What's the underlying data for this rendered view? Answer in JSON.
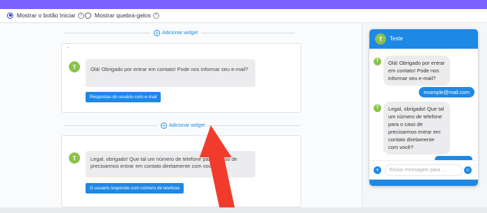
{
  "colors": {
    "top_bar": "#7b61ff",
    "accent": "#1e88e5",
    "avatar": "#8bc34a",
    "arrow": "#f13b2d"
  },
  "options": {
    "show_start_button": "Mostrar o botão Iniciar",
    "show_icebreakers": "Mostrar quebra-gelos",
    "help_glyph": "?"
  },
  "add_widget": "Adicionar widget",
  "add_glyph": "+",
  "avatar_letter": "T",
  "card1": {
    "dot": "·",
    "message": "Olá! Obrigado por entrar em contato! Pode nos informar seu e-mail?",
    "button": "Respostas do usuário com e-mail"
  },
  "card2": {
    "message_line1": "Legal, obrigado! Que tal um número de telefone para o caso de",
    "message_line2": "precisarmos entrar em contato diretamente com você?",
    "button": "O usuário responde com número de telefone"
  },
  "widget": {
    "title": "Teste",
    "messages": [
      "Olá! Obrigado por entrar em contato! Pode nos informar seu e-mail?",
      "example@mail.com",
      "Legal, obrigado! Que tal um número de telefone para o caso de precisarmos entrar em contato diretamente com você?"
    ],
    "input_placeholder": "Enviar mensagem para ...",
    "plus_glyph": "+",
    "emoji_glyph": "☺"
  }
}
